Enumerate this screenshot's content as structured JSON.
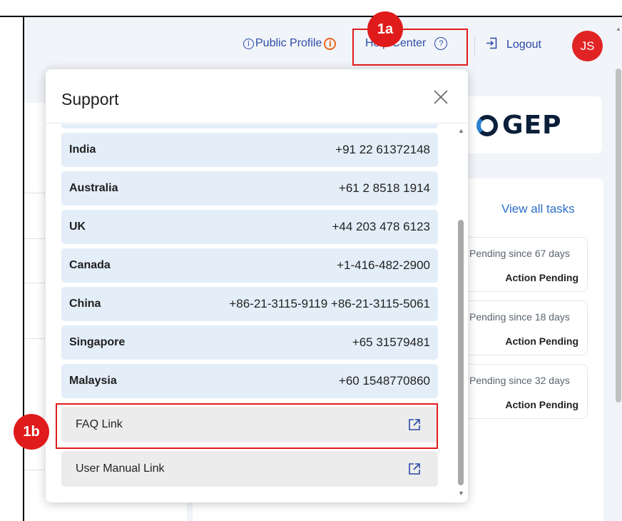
{
  "header": {
    "public_profile": "Public Profile",
    "help_center": "Help Center",
    "logout": "Logout",
    "avatar_initials": "JS"
  },
  "brand": {
    "logo_text": "GEP"
  },
  "tasks": {
    "view_all": "View all tasks",
    "items": [
      {
        "since": "Pending since 67 days",
        "status": "Action Pending"
      },
      {
        "since": "Pending since 18 days",
        "status": "Action Pending"
      },
      {
        "since": "Pending since 32 days",
        "status": "Action Pending"
      }
    ]
  },
  "modal": {
    "title": "Support",
    "contacts": [
      {
        "country": "India",
        "phone": "+91 22 61372148"
      },
      {
        "country": "Australia",
        "phone": "+61 2 8518 1914"
      },
      {
        "country": "UK",
        "phone": "+44 203 478 6123"
      },
      {
        "country": "Canada",
        "phone": "+1-416-482-2900"
      },
      {
        "country": "China",
        "phone": "+86-21-3115-9119 +86-21-3115-5061"
      },
      {
        "country": "Singapore",
        "phone": "+65 31579481"
      },
      {
        "country": "Malaysia",
        "phone": "+60 1548770860"
      }
    ],
    "links": [
      {
        "label": "FAQ Link"
      },
      {
        "label": "User Manual Link"
      }
    ]
  },
  "annotations": {
    "badge_1a": "1a",
    "badge_1b": "1b",
    "color": "#e01b1b"
  },
  "colors": {
    "avatar_bg": "#e02424",
    "link_blue": "#2b4aa8",
    "row_bg": "#e3eef9",
    "link_row_bg": "#ececec"
  }
}
